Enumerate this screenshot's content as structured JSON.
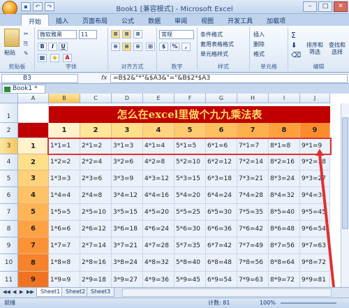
{
  "window": {
    "title": "Book1 [兼容模式] - Microsoft Excel"
  },
  "qat": [
    "save",
    "undo",
    "redo"
  ],
  "tabs": [
    "开始",
    "插入",
    "页面布局",
    "公式",
    "数据",
    "审阅",
    "视图",
    "开发工具",
    "加载项"
  ],
  "ribbon": {
    "clipboard": {
      "label": "剪贴板",
      "paste": "粘贴"
    },
    "font": {
      "label": "字体",
      "name": "微软雅黑",
      "size": "11",
      "bold": "B",
      "italic": "I",
      "underline": "U"
    },
    "alignment": {
      "label": "对齐方式"
    },
    "number": {
      "label": "数字",
      "format": "常规"
    },
    "styles": {
      "label": "样式",
      "conditional": "条件格式",
      "table": "套用表格格式",
      "cell": "单元格样式"
    },
    "cells": {
      "label": "单元格",
      "insert": "插入",
      "delete": "删除",
      "format": "格式"
    },
    "editing": {
      "label": "编辑",
      "sort": "排序和筛选",
      "find": "查找和选择",
      "sigma": "Σ"
    }
  },
  "formula_bar": {
    "name_box": "B3",
    "fx": "fx",
    "formula": "=B$2&\"*\"&$A3&\"=\"&B$2*$A3"
  },
  "workbook_tab": "Book1 *",
  "columns": [
    "A",
    "B",
    "C",
    "D",
    "E",
    "F",
    "G",
    "H",
    "I",
    "J"
  ],
  "rows": [
    "1",
    "2",
    "3",
    "4",
    "5",
    "6",
    "7",
    "8",
    "9",
    "10",
    "11"
  ],
  "sheet_title": "怎么在excel里做个九九乘法表",
  "header_numbers": [
    "1",
    "2",
    "3",
    "4",
    "5",
    "6",
    "7",
    "8",
    "9"
  ],
  "row_numbers": [
    "1",
    "2",
    "3",
    "4",
    "5",
    "6",
    "7",
    "8",
    "9"
  ],
  "grid": [
    [
      "1*1=1",
      "2*1=2",
      "3*1=3",
      "4*1=4",
      "5*1=5",
      "6*1=6",
      "7*1=7",
      "8*1=8",
      "9*1=9"
    ],
    [
      "1*2=2",
      "2*2=4",
      "3*2=6",
      "4*2=8",
      "5*2=10",
      "6*2=12",
      "7*2=14",
      "8*2=16",
      "9*2=18"
    ],
    [
      "1*3=3",
      "2*3=6",
      "3*3=9",
      "4*3=12",
      "5*3=15",
      "6*3=18",
      "7*3=21",
      "8*3=24",
      "9*3=27"
    ],
    [
      "1*4=4",
      "2*4=8",
      "3*4=12",
      "4*4=16",
      "5*4=20",
      "6*4=24",
      "7*4=28",
      "8*4=32",
      "9*4=36"
    ],
    [
      "1*5=5",
      "2*5=10",
      "3*5=15",
      "4*5=20",
      "5*5=25",
      "6*5=30",
      "7*5=35",
      "8*5=40",
      "9*5=45"
    ],
    [
      "1*6=6",
      "2*6=12",
      "3*6=18",
      "4*6=24",
      "5*6=30",
      "6*6=36",
      "7*6=42",
      "8*6=48",
      "9*6=54"
    ],
    [
      "1*7=7",
      "2*7=14",
      "3*7=21",
      "4*7=28",
      "5*7=35",
      "6*7=42",
      "7*7=49",
      "8*7=56",
      "9*7=63"
    ],
    [
      "1*8=8",
      "2*8=16",
      "3*8=24",
      "4*8=32",
      "5*8=40",
      "6*8=48",
      "7*8=56",
      "8*8=64",
      "9*8=72"
    ],
    [
      "1*9=9",
      "2*9=18",
      "3*9=27",
      "4*9=36",
      "5*9=45",
      "6*9=54",
      "7*9=63",
      "8*9=72",
      "9*9=81"
    ]
  ],
  "sheets": [
    "Sheet1",
    "Sheet2",
    "Sheet3"
  ],
  "status": {
    "mode": "就绪",
    "count": "计数: 81",
    "zoom": "100%"
  },
  "colors": {
    "title_bg": "#c00000",
    "title_fg": "#ffd966",
    "row1_header": "#ffe699",
    "highlight": "#e03030"
  }
}
